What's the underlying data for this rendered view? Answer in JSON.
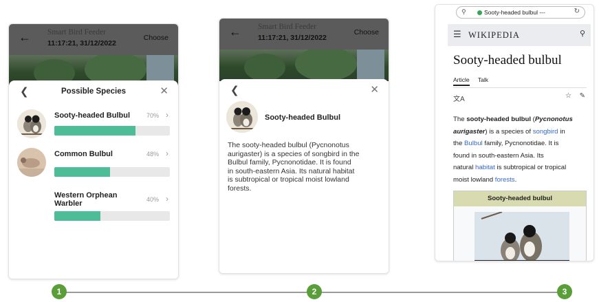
{
  "screen1": {
    "appbar": {
      "title": "Smart Bird Feeder",
      "time": "11:17:21, 31/12/2022",
      "action": "Choose"
    },
    "sheet": {
      "title": "Possible Species",
      "species": [
        {
          "name": "Sooty-headed Bulbul",
          "percent": "70%",
          "confidence": 0.7
        },
        {
          "name": "Common Bulbul",
          "percent": "48%",
          "confidence": 0.48
        },
        {
          "name_line1": "Western Orphean",
          "name_line2": "Warbler",
          "percent": "40%",
          "confidence": 0.4
        }
      ]
    }
  },
  "screen2": {
    "appbar": {
      "title": "Smart Bird Feeder",
      "time": "11:17:21, 31/12/2022",
      "action": "Choose"
    },
    "detail": {
      "name": "Sooty-headed Bulbul",
      "lines": [
        "The sooty-headed bulbul (Pycnonotus",
        "aurigaster) is a species of songbird in the",
        "Bulbul family, Pycnonotidae. It is found",
        "in south-eastern Asia. Its natural habitat",
        "is subtropical or tropical moist lowland",
        "forests."
      ]
    }
  },
  "screen3": {
    "browser": {
      "url": "Sooty-headed bulbul ---"
    },
    "wiki": {
      "logo": "WIKIPEDIA",
      "title": "Sooty-headed bulbul",
      "tabs": [
        "Article",
        "Talk"
      ],
      "body": {
        "l1_a": "The ",
        "l1_b": "sooty-headed bulbul",
        "l1_c": " (",
        "l1_d": "Pycnonotus",
        "l2_a": "aurigaster",
        "l2_b": ") is a species of ",
        "l2_c": "songbird",
        "l2_d": " in",
        "l3_a": "the ",
        "l3_b": "Bulbul",
        "l3_c": " family, Pycnonotidae. It is",
        "l4": "found in south-eastern Asia. Its",
        "l5_a": "natural ",
        "l5_b": "habitat",
        "l5_c": " is subtropical or tropical",
        "l6_a": "moist lowland ",
        "l6_b": "forests",
        "l6_c": "."
      },
      "infobox_title": "Sooty-headed bulbul"
    }
  },
  "timeline": {
    "steps": [
      "1",
      "2",
      "3"
    ]
  },
  "colors": {
    "accent": "#4dbd98",
    "step": "#5a9e3a",
    "link": "#3366cc"
  }
}
